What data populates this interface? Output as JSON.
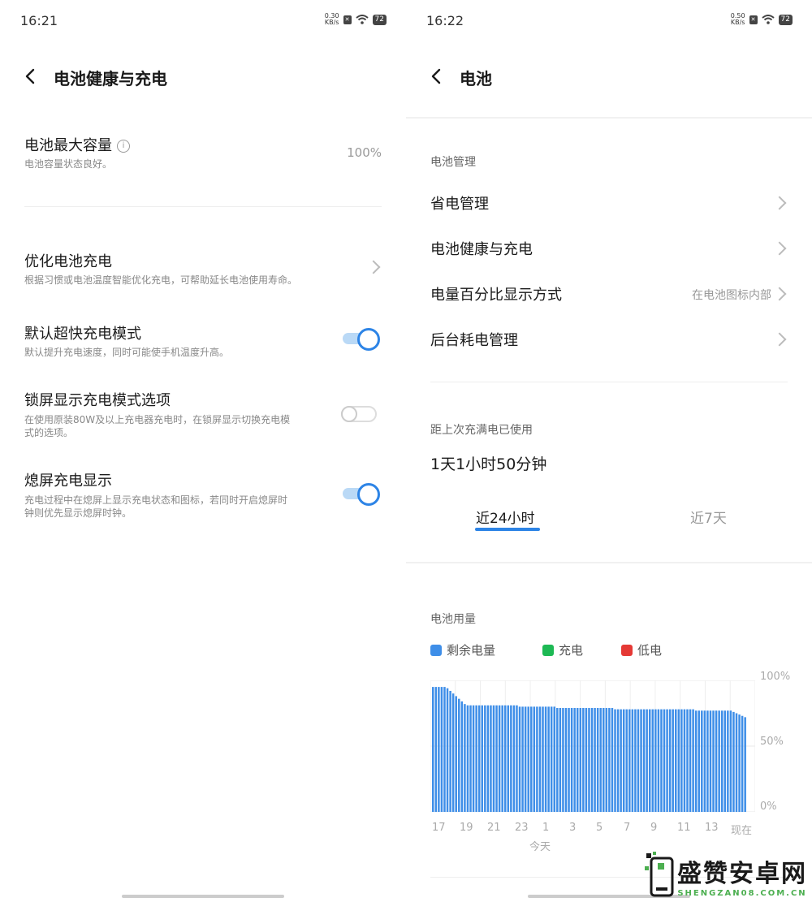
{
  "left": {
    "status": {
      "time": "16:21",
      "net_speed": "0.30",
      "net_unit": "KB/s",
      "battery": "72"
    },
    "title": "电池健康与充电",
    "capacity": {
      "label": "电池最大容量",
      "desc": "电池容量状态良好。",
      "value": "100%"
    },
    "optimize": {
      "label": "优化电池充电",
      "desc": "根据习惯或电池温度智能优化充电，可帮助延长电池使用寿命。"
    },
    "superfast": {
      "label": "默认超快充电模式",
      "desc": "默认提升充电速度，同时可能使手机温度升高。",
      "enabled": true
    },
    "lockscreen": {
      "label": "锁屏显示充电模式选项",
      "desc1": "在使用原装80W及以上充电器充电时，在锁屏显示切换充电模",
      "desc2": "式的选项。",
      "enabled": false
    },
    "aod": {
      "label": "熄屏充电显示",
      "desc1": "充电过程中在熄屏上显示充电状态和图标，若同时开启熄屏时",
      "desc2": "钟则优先显示熄屏时钟。",
      "enabled": true
    }
  },
  "right": {
    "status": {
      "time": "16:22",
      "net_speed": "0.50",
      "net_unit": "KB/s",
      "battery": "72"
    },
    "title": "电池",
    "section_manage": "电池管理",
    "menu": [
      {
        "label": "省电管理",
        "value": ""
      },
      {
        "label": "电池健康与充电",
        "value": ""
      },
      {
        "label": "电量百分比显示方式",
        "value": "在电池图标内部"
      },
      {
        "label": "后台耗电管理",
        "value": ""
      }
    ],
    "since_full_label": "距上次充满电已使用",
    "since_full_value": "1天1小时50分钟",
    "tabs": [
      {
        "label": "近24小时",
        "active": true
      },
      {
        "label": "近7天",
        "active": false
      }
    ],
    "usage_label": "电池用量",
    "legend": [
      {
        "label": "剩余电量",
        "color": "#3e8ee8"
      },
      {
        "label": "充电",
        "color": "#1db954"
      },
      {
        "label": "低电",
        "color": "#e53935"
      }
    ],
    "watermark": {
      "text": "盛赞安卓网",
      "url": "SHENGZAN08.COM.CN"
    }
  },
  "chart_data": {
    "type": "bar",
    "title": "电池用量",
    "ylim": [
      0,
      100
    ],
    "y_ticks": [
      "100%",
      "50%",
      "0%"
    ],
    "x_ticks": [
      "17",
      "19",
      "21",
      "23",
      "1",
      "3",
      "5",
      "7",
      "9",
      "11",
      "13",
      "现在"
    ],
    "x_sublabel": "今天",
    "series": [
      {
        "name": "剩余电量",
        "color": "#3e8ee8",
        "values": [
          95,
          95,
          95,
          95,
          95,
          94,
          92,
          90,
          88,
          86,
          84,
          82,
          81,
          81,
          81,
          81,
          81,
          81,
          81,
          81,
          81,
          81,
          81,
          81,
          81,
          81,
          81,
          81,
          81,
          81,
          80,
          80,
          80,
          80,
          80,
          80,
          80,
          80,
          80,
          80,
          80,
          80,
          80,
          79,
          79,
          79,
          79,
          79,
          79,
          79,
          79,
          79,
          79,
          79,
          79,
          79,
          79,
          79,
          79,
          79,
          79,
          79,
          79,
          78,
          78,
          78,
          78,
          78,
          78,
          78,
          78,
          78,
          78,
          78,
          78,
          78,
          78,
          78,
          78,
          78,
          78,
          78,
          78,
          78,
          78,
          78,
          78,
          78,
          78,
          78,
          78,
          77,
          77,
          77,
          77,
          77,
          77,
          77,
          77,
          77,
          77,
          77,
          77,
          77,
          76,
          75,
          74,
          73,
          72
        ]
      }
    ]
  }
}
